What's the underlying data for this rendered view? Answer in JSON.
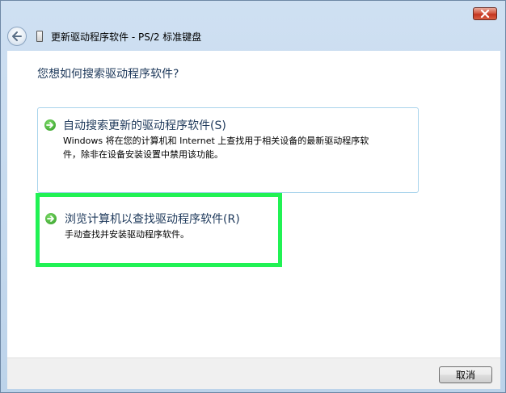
{
  "window": {
    "title": "更新驱动程序软件 - PS/2 标准键盘",
    "close_icon": "close-icon"
  },
  "navigation": {
    "back_icon": "back-arrow-icon"
  },
  "content": {
    "question": "您想如何搜索驱动程序软件?",
    "options": [
      {
        "title": "自动搜索更新的驱动程序软件(S)",
        "description_line1": "Windows 将在您的计算机和 Internet 上查找用于相关设备的最新驱动程序软",
        "description_line2": "件，除非在设备安装设置中禁用该功能。",
        "icon": "green-arrow-icon"
      },
      {
        "title": "浏览计算机以查找驱动程序软件(R)",
        "description_line1": "手动查找并安装驱动程序软件。",
        "icon": "green-arrow-icon",
        "highlight_color": "#21f254"
      }
    ]
  },
  "footer": {
    "cancel_label": "取消"
  }
}
